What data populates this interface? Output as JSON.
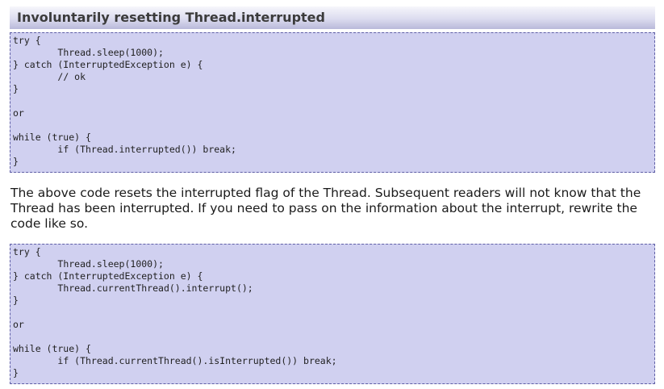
{
  "section": {
    "title": "Involuntarily resetting Thread.interrupted"
  },
  "example_one": {
    "code": "try {\n\tThread.sleep(1000);\n} catch (InterruptedException e) {\n\t// ok\n}\n\nor\n\nwhile (true) {\n\tif (Thread.interrupted()) break;\n}"
  },
  "explanation": {
    "text": "The above code resets the interrupted flag of the Thread. Subsequent readers will not know that the Thread has been interrupted. If you need to pass on the information about the interrupt, rewrite the code like so."
  },
  "example_two": {
    "code": "try {\n\tThread.sleep(1000);\n} catch (InterruptedException e) {\n\tThread.currentThread().interrupt();\n}\n\nor\n\nwhile (true) {\n\tif (Thread.currentThread().isInterrupted()) break;\n}"
  }
}
